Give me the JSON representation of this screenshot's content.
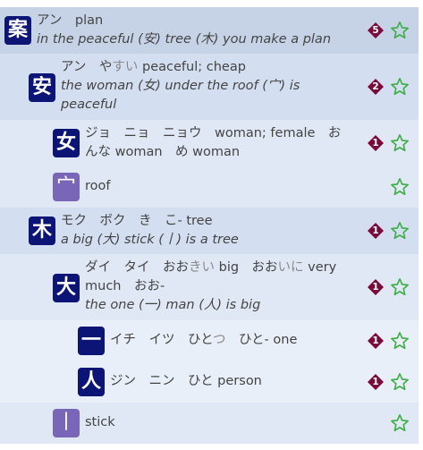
{
  "colors": {
    "kanji_bg": "#0c1475",
    "radical_bg": "#7a66b8",
    "badge": "#7a0a3a",
    "star": "#3fae49",
    "level0": "#c6d3e6",
    "level1": "#d3def0",
    "level2": "#e0e8f5",
    "level3": "#e9eff8"
  },
  "rows": [
    {
      "kanji": "案",
      "reading": "アン　plan",
      "mnemonic": "in the peaceful (安) tree (木) you make a plan",
      "badge": "5"
    },
    {
      "kanji": "安",
      "reading_pre": "アン　や",
      "reading_hl": "すい",
      "reading_post": " peaceful; cheap",
      "mnemonic": "the woman (女) under the roof (宀) is peaceful",
      "badge": "2"
    },
    {
      "kanji": "女",
      "reading": "ジョ　ニョ　ニョウ　woman; female　おんな woman　め woman",
      "badge": "1"
    },
    {
      "kanji": "宀",
      "reading": "roof"
    },
    {
      "kanji": "木",
      "reading": "モク　ボク　き　こ- tree",
      "mnemonic": "a big (大) stick (丨) is a tree",
      "badge": "1"
    },
    {
      "kanji": "大",
      "reading_parts": [
        "ダイ　タイ　おお",
        "きい",
        " big　おお",
        "いに",
        " very much　おお-"
      ],
      "mnemonic": "the one (一) man (人) is big",
      "badge": "1"
    },
    {
      "kanji": "一",
      "reading_pre": "イチ　イツ　ひと",
      "reading_hl": "つ",
      "reading_post": "　ひと- one",
      "badge": "1"
    },
    {
      "kanji": "人",
      "reading": "ジン　ニン　ひと person",
      "badge": "1"
    },
    {
      "kanji": "丨",
      "reading": "stick"
    }
  ]
}
